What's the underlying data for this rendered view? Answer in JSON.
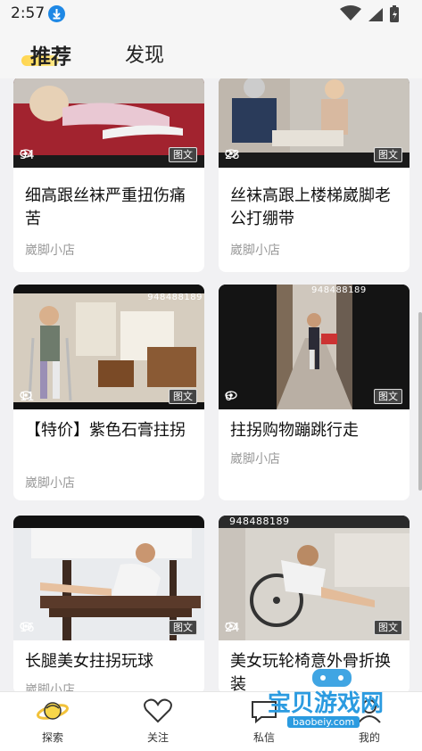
{
  "status_bar": {
    "time": "2:57"
  },
  "header": {
    "tabs": [
      {
        "label": "推荐",
        "active": true
      },
      {
        "label": "发现",
        "active": false
      }
    ]
  },
  "feed": [
    {
      "title": "细高跟丝袜严重扭伤痛苦",
      "views": "34",
      "badge": "图文",
      "shop": "崴脚小店"
    },
    {
      "title": "丝袜高跟上楼梯崴脚老公打绷带",
      "views": "28",
      "badge": "图文",
      "shop": "崴脚小店"
    },
    {
      "title": "【特价】紫色石膏拄拐",
      "views": "11",
      "badge": "图文",
      "shop": "崴脚小店",
      "watermark": "948488189"
    },
    {
      "title": "拄拐购物蹦跳行走",
      "views": "6",
      "badge": "图文",
      "shop": "崴脚小店",
      "watermark": "948488189"
    },
    {
      "title": "长腿美女拄拐玩球",
      "views": "16",
      "badge": "图文",
      "shop": "崴脚小店"
    },
    {
      "title": "美女玩轮椅意外骨折换装",
      "views": "24",
      "badge": "图文",
      "shop": "",
      "watermark": "948488189"
    }
  ],
  "bottom_nav": [
    {
      "label": "探索",
      "icon": "planet-icon",
      "active": true
    },
    {
      "label": "关注",
      "icon": "heart-icon"
    },
    {
      "label": "私信",
      "icon": "chat-icon"
    },
    {
      "label": "我的",
      "icon": "person-icon"
    }
  ],
  "brand_watermark": {
    "text": "宝贝游戏网",
    "url_text": "baobeiy.com"
  },
  "colors": {
    "accent": "#ffd54f",
    "background": "#f1f1f3",
    "download_badge": "#1e88e5"
  }
}
